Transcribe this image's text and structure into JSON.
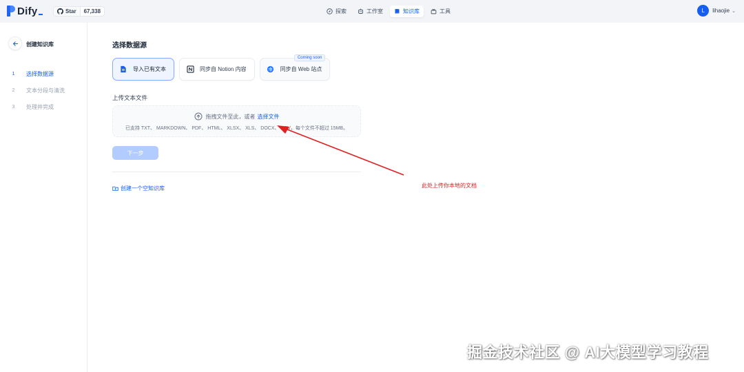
{
  "header": {
    "logo_text": "Dify",
    "github": {
      "star_label": "Star",
      "count": "67,338"
    },
    "nav": [
      {
        "label": "探索",
        "icon": "compass-icon"
      },
      {
        "label": "工作室",
        "icon": "robot-icon"
      },
      {
        "label": "知识库",
        "icon": "book-icon",
        "active": true
      },
      {
        "label": "工具",
        "icon": "toolbox-icon"
      }
    ],
    "user": {
      "avatar_letter": "L",
      "name": "lihaojie"
    }
  },
  "sidebar": {
    "title": "创建知识库",
    "steps": [
      {
        "num": "1",
        "label": "选择数据源",
        "active": true
      },
      {
        "num": "2",
        "label": "文本分段与清洗"
      },
      {
        "num": "3",
        "label": "处理并完成"
      }
    ]
  },
  "main": {
    "title": "选择数据源",
    "sources": [
      {
        "label": "导入已有文本",
        "icon": "file-text-icon",
        "active": true
      },
      {
        "label": "同步自 Notion 内容",
        "icon": "notion-icon"
      },
      {
        "label": "同步自 Web 站点",
        "icon": "web-icon",
        "badge": "Coming soon"
      }
    ],
    "upload_label": "上传文本文件",
    "dropzone": {
      "prompt": "拖拽文件至此，或者",
      "link": "选择文件",
      "formats": "已支持 TXT、 MARKDOWN、 PDF、 HTML、 XLSX、 XLS、 DOCX、 CSV，每个文件不超过 15MB。"
    },
    "next_button": "下一步",
    "empty_kb_link": "创建一个空知识库"
  },
  "annotation": {
    "text": "此处上传你本地的文档",
    "color": "#e02020"
  },
  "watermark": "掘金技术社区 @ AI大模型学习教程",
  "colors": {
    "accent": "#155eef",
    "annotation": "#e02020"
  }
}
